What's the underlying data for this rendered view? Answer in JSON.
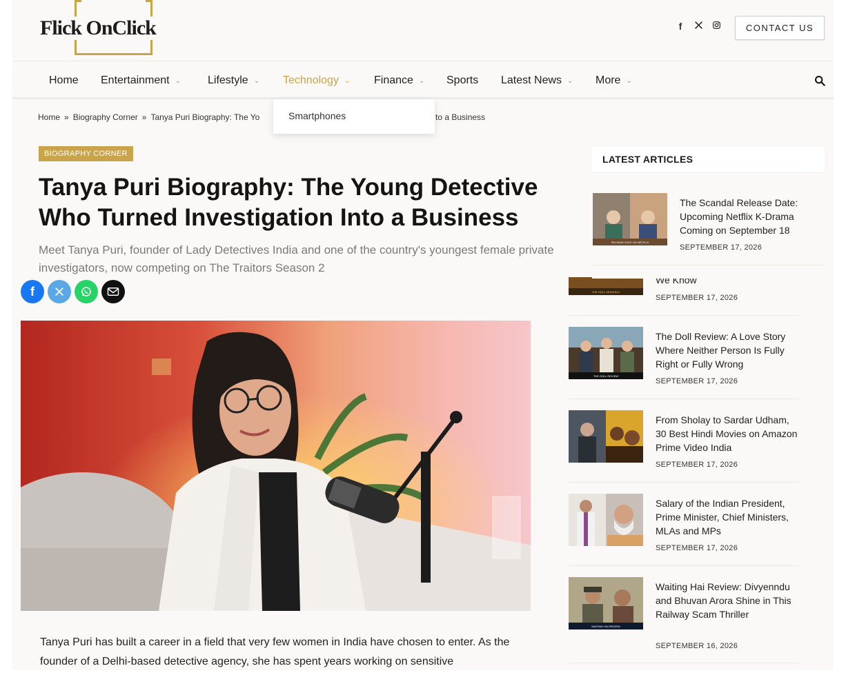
{
  "brand": {
    "logo_text": "Flick OnClick",
    "accent": "#c9a44a"
  },
  "header": {
    "contact_label": "CONTACT US",
    "social": [
      "facebook-icon",
      "x-icon",
      "instagram-icon"
    ]
  },
  "nav": {
    "items": [
      {
        "label": "Home"
      },
      {
        "label": "Entertainment"
      },
      {
        "label": "Lifestyle"
      },
      {
        "label": "Technology"
      },
      {
        "label": "Finance"
      },
      {
        "label": "Sports"
      },
      {
        "label": "Latest News"
      },
      {
        "label": "More"
      }
    ],
    "active": "Technology",
    "dropdown": [
      "Smartphones"
    ]
  },
  "breadcrumb": {
    "home": "Home",
    "section": "Biography Corner",
    "current_visible": "Tanya Puri Biography: The Yo",
    "current_tail": "to a Business"
  },
  "article": {
    "category": "BIOGRAPHY CORNER",
    "title": "Tanya Puri Biography: The Young Detective Who Turned Investigation Into a Business",
    "subtitle": "Meet Tanya Puri, founder of Lady Detectives India and one of the country's youngest female private investigators, now competing on The Traitors Season 2",
    "body": "Tanya Puri has built a career in a field that very few women in India have chosen to enter. As the founder of a Delhi-based detective agency, she has spent years working on sensitive"
  },
  "sidebar": {
    "heading": "LATEST ARTICLES",
    "articles": [
      {
        "title": "The Scandal Release Date: Upcoming Netflix K-Drama Coming on September 18",
        "date": "SEPTEMBER 17, 2026"
      },
      {
        "title": "We Know",
        "date": "SEPTEMBER 17, 2026"
      },
      {
        "title": "The Doll Review: A Love Story Where Neither Person Is Fully Right or Fully Wrong",
        "date": "SEPTEMBER 17, 2026"
      },
      {
        "title": "From Sholay to Sardar Udham, 30 Best Hindi Movies on Amazon Prime Video India",
        "date": "SEPTEMBER 17, 2026"
      },
      {
        "title": "Salary of the Indian President, Prime Minister, Chief Ministers, MLAs and MPs",
        "date": "SEPTEMBER 17, 2026"
      },
      {
        "title": "Waiting Hai Review: Divyenndu and Bhuvan Arora Shine in This Railway Scam Thriller",
        "date": "SEPTEMBER 16, 2026"
      }
    ],
    "thumb_captions": [
      "RELEASE DATE ON NETFLIX",
      "THE DOLL SEASON 2",
      "THE DOLL REVIEW",
      "WAITING HAI REVIEW"
    ]
  }
}
